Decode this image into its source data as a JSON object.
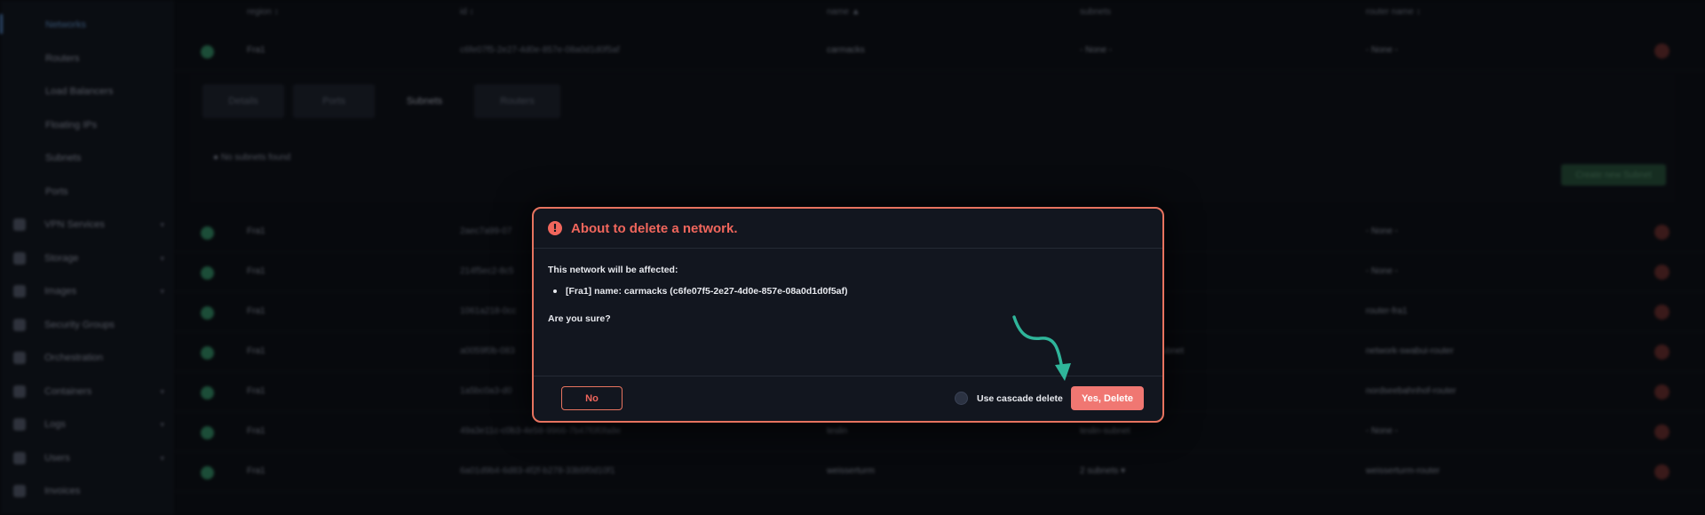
{
  "sidebar": {
    "items": [
      {
        "label": "Networks",
        "active": true
      },
      {
        "label": "Routers"
      },
      {
        "label": "Load Balancers"
      },
      {
        "label": "Floating IPs"
      },
      {
        "label": "Subnets"
      },
      {
        "label": "Ports"
      },
      {
        "label": "VPN Services",
        "icon": "lock-icon",
        "expandable": true
      },
      {
        "label": "Storage",
        "icon": "storage-icon",
        "expandable": true
      },
      {
        "label": "Images",
        "icon": "image-icon",
        "expandable": true
      },
      {
        "label": "Security Groups",
        "icon": "shield-icon"
      },
      {
        "label": "Orchestration",
        "icon": "orchestration-icon"
      },
      {
        "label": "Containers",
        "icon": "container-icon",
        "expandable": true
      },
      {
        "label": "Logs",
        "icon": "history-icon",
        "expandable": true
      },
      {
        "label": "Users",
        "icon": "user-icon",
        "expandable": true
      },
      {
        "label": "Invoices",
        "icon": "invoice-icon"
      }
    ]
  },
  "table": {
    "headers": {
      "region": "region ↕",
      "id": "id ↕",
      "name": "name ▲",
      "subnets": "subnets",
      "router_name": "router name ↕"
    },
    "rows": [
      {
        "region": "Fra1",
        "id": "c6fe07f5-2e27-4d0e-857e-08a0d1d0f5af",
        "name": "carmacks",
        "subnets": "- None -",
        "router": "- None -"
      },
      {
        "region": "Fra1",
        "id": "2aec7a99-07",
        "name": "",
        "subnets": "",
        "router": "- None -"
      },
      {
        "region": "Fra1",
        "id": "214f5ec2-8c5",
        "name": "",
        "subnets": "",
        "router": "- None -"
      },
      {
        "region": "Fra1",
        "id": "1061a218-0cc",
        "name": "",
        "subnets": "",
        "router": "router-fra1"
      },
      {
        "region": "Fra1",
        "id": "a0059f0b-083",
        "name": "",
        "subnets": "ubnet",
        "router": "network-swabui-router"
      },
      {
        "region": "Fra1",
        "id": "1a5bc0a3-d0",
        "name": "",
        "subnets": "",
        "router": "nordseebahnhof-router"
      },
      {
        "region": "Fra1",
        "id": "49a3e11c-c0b3-4e58-9966-7b47f0f0fa8e",
        "name": "teslin",
        "subnets": "teslin-subnet",
        "router": "- None -"
      },
      {
        "region": "Fra1",
        "id": "6a01d9b4-6d83-4f2f-b278-33b5f0d10f1",
        "name": "weisserturm",
        "subnets": "2 subnets ▾",
        "router": "weisserturm-router"
      }
    ]
  },
  "expanded": {
    "tabs": [
      "Details",
      "Ports",
      "Subnets",
      "Routers"
    ],
    "selected_tab": "Subnets",
    "empty_message": "No subnets found",
    "create_button": "Create new Subnet"
  },
  "modal": {
    "title": "About to delete a network.",
    "affected_label": "This network will be affected:",
    "affected_item": "[Fra1] name: carmacks (c6fe07f5-2e27-4d0e-857e-08a0d1d0f5af)",
    "question": "Are you sure?",
    "no_label": "No",
    "cascade_label": "Use cascade delete",
    "yes_label": "Yes, Delete"
  },
  "colors": {
    "accent_danger": "#f0665c",
    "modal_border": "#e7735f",
    "arrow": "#2fb59a",
    "success": "#2e7d5b"
  }
}
